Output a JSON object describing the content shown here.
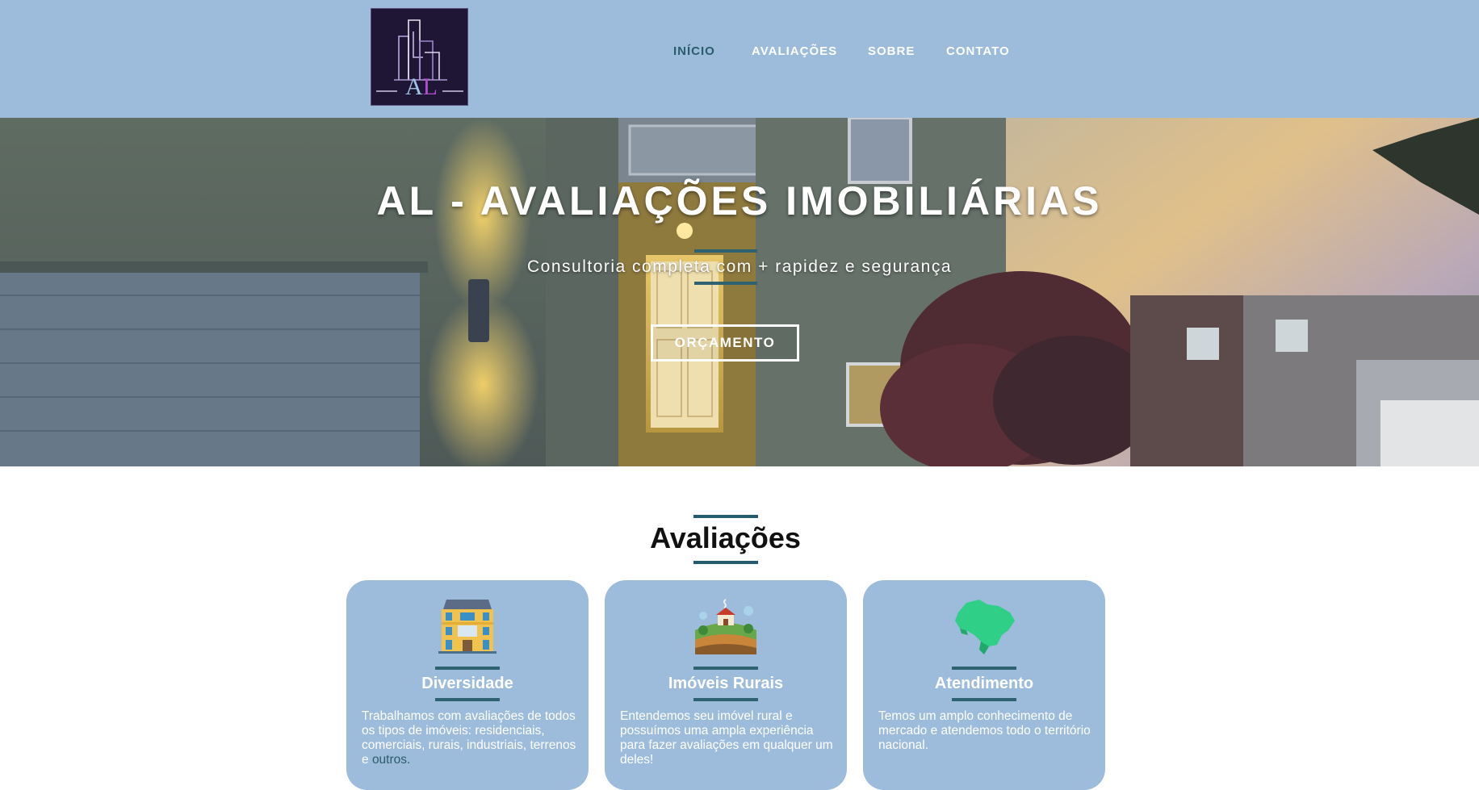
{
  "logo": {
    "text": "AL",
    "icon": "city-buildings-logo"
  },
  "nav": {
    "items": [
      {
        "label": "INÍCIO",
        "active": true
      },
      {
        "label": "AVALIAÇÕES",
        "active": false
      },
      {
        "label": "SOBRE",
        "active": false
      },
      {
        "label": "CONTATO",
        "active": false
      }
    ]
  },
  "hero": {
    "title": "AL - AVALIAÇÕES IMOBILIÁRIAS",
    "subtitle": "Consultoria completa com + rapidez e segurança",
    "cta_label": "ORÇAMENTO"
  },
  "section": {
    "title": "Avaliações",
    "cards": [
      {
        "icon": "building-icon",
        "title": "Diversidade",
        "text": "Trabalhamos com avaliações de todos os tipos de imóveis: residenciais, comerciais, rurais, industriais, terrenos e ",
        "text_link": "outros."
      },
      {
        "icon": "farm-house-icon",
        "title": "Imóveis Rurais",
        "text": "Entendemos seu imóvel rural e possuímos uma ampla experiência para fazer avaliações em qualquer um deles!",
        "text_link": ""
      },
      {
        "icon": "brazil-map-icon",
        "title": "Atendimento",
        "text": "Temos um amplo conhecimento de mercado e atendemos todo o território nacional.",
        "text_link": ""
      }
    ]
  },
  "colors": {
    "header_bg": "#9dbbda",
    "accent_dark": "#2a5d6a",
    "card_bg": "#9dbbda",
    "section_line": "#255b70"
  }
}
